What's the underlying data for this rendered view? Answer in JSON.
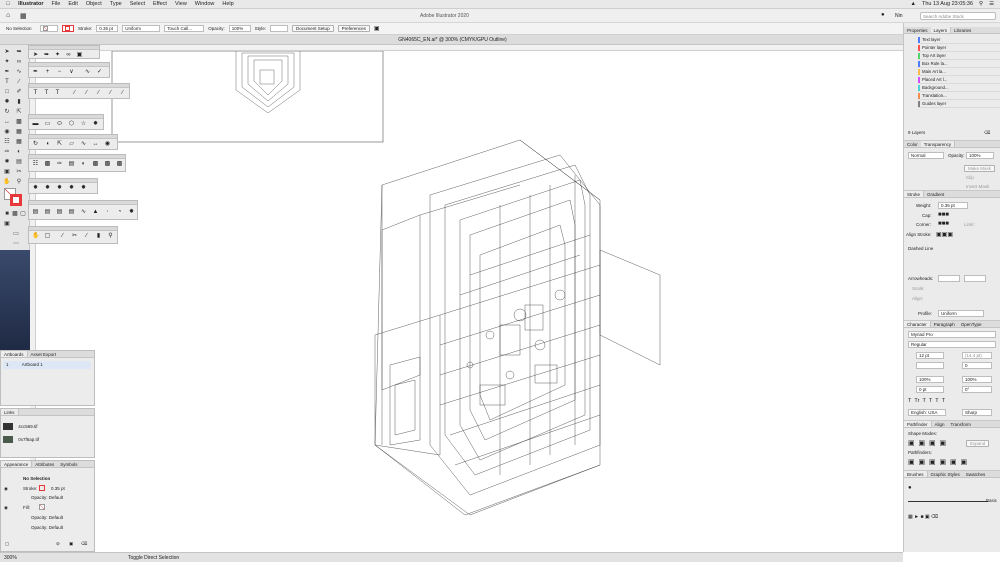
{
  "menubar": {
    "apple": "",
    "app": "Illustrator",
    "items": [
      "File",
      "Edit",
      "Object",
      "Type",
      "Select",
      "Effect",
      "View",
      "Window",
      "Help"
    ],
    "clock": "Thu 13 Aug  23:05:36"
  },
  "appbar": {
    "title": "Adobe Illustrator 2020",
    "search_placeholder": "Search Adobe Stock",
    "user": "Nin"
  },
  "control": {
    "selection": "No Selection",
    "stroke_label": "Stroke:",
    "stroke_value": "0.35 pt",
    "profile": "Uniform",
    "brush": "Touch Call...",
    "opacity_label": "Opacity:",
    "opacity_value": "100%",
    "style_label": "Style:",
    "document_setup": "Document Setup",
    "preferences": "Preferences"
  },
  "doc_tab": "GN4065C_EN.ai* @ 300% (CMYK/GPU Outline)",
  "artboards_panel": {
    "tabs": [
      "Artboards",
      "Asset Export"
    ],
    "rows": [
      {
        "num": "1",
        "name": "Artboard 1"
      }
    ]
  },
  "links_panel": {
    "tabs": [
      "Links"
    ],
    "rows": [
      "4cc569.tif",
      "0x7f6ap.tif"
    ]
  },
  "appearance_panel": {
    "tabs": [
      "Appearance",
      "Attributes",
      "Symbols"
    ],
    "title": "No Selection",
    "stroke_label": "Stroke:",
    "stroke_value": "0.35 pt",
    "opacity1": "Opacity: Default",
    "fill_label": "Fill:",
    "opacity2": "Opacity: Default",
    "opacity3": "Opacity: Default"
  },
  "status": {
    "zoom": "300%",
    "hint": "Toggle Direct Selection"
  },
  "layers_panel": {
    "tabs": [
      "Properties",
      "Layers",
      "Libraries"
    ],
    "layers": [
      {
        "name": "Text layer",
        "color": "#4f7cff"
      },
      {
        "name": "Pointer layer",
        "color": "#ff4f4f"
      },
      {
        "name": "Top Art layer",
        "color": "#4fd46b"
      },
      {
        "name": "Box Rule la...",
        "color": "#4f7cff"
      },
      {
        "name": "Main Art la...",
        "color": "#ffb84f"
      },
      {
        "name": "Placed Art l...",
        "color": "#d24fff"
      },
      {
        "name": "Background...",
        "color": "#4fd4d4"
      },
      {
        "name": "Translation...",
        "color": "#ff8c4f"
      },
      {
        "name": "Guides layer",
        "color": "#7f7f7f"
      }
    ],
    "count": "9 Layers"
  },
  "transparency_panel": {
    "tabs": [
      "Color",
      "Transparency"
    ],
    "mode": "Normal",
    "opacity_label": "Opacity:",
    "opacity": "100%",
    "make_mask": "Make Mask",
    "clip": "Clip",
    "invert": "Invert Mask"
  },
  "stroke_panel": {
    "tabs": [
      "Stroke",
      "Gradient"
    ],
    "weight_label": "Weight:",
    "weight": "0.35 pt",
    "cap_label": "Cap:",
    "corner_label": "Corner:",
    "limit_label": "Limit:",
    "align_label": "Align Stroke:",
    "dashed": "Dashed Line",
    "arrowheads": "Arrowheads:",
    "scale": "Scale:",
    "align": "Align:",
    "profile_label": "Profile:",
    "profile": "Uniform"
  },
  "character_panel": {
    "tabs": [
      "Character",
      "Paragraph",
      "OpenType"
    ],
    "font": "Myriad Pro",
    "style": "Regular",
    "size": "12 pt",
    "leading": "(14.4 pt)",
    "kerning": "",
    "tracking": "0",
    "vscale": "100%",
    "hscale": "100%",
    "baseline": "0 pt",
    "rotation": "0°",
    "language": "English: USA",
    "aa": "Sharp"
  },
  "pathfinder_panel": {
    "tabs": [
      "Pathfinder",
      "Align",
      "Transform"
    ],
    "shape_modes": "Shape Modes:",
    "expand": "Expand",
    "pathfinders": "Pathfinders:"
  },
  "brushes_panel": {
    "tabs": [
      "Brushes",
      "Graphic Styles",
      "Swatches"
    ],
    "basic": "Basic"
  },
  "colors": {
    "accent": "#e6383b",
    "selection": "#1473e6"
  }
}
